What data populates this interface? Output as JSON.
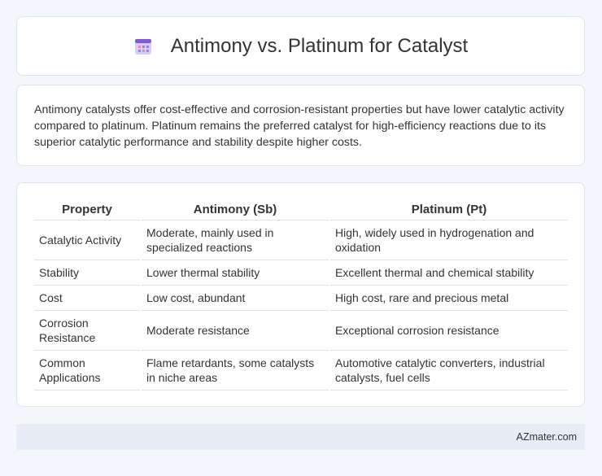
{
  "header": {
    "title": "Antimony vs. Platinum for Catalyst",
    "icon": "calendar-icon"
  },
  "summary": {
    "text": "Antimony catalysts offer cost-effective and corrosion-resistant properties but have lower catalytic activity compared to platinum. Platinum remains the preferred catalyst for high-efficiency reactions due to its superior catalytic performance and stability despite higher costs."
  },
  "table": {
    "headers": [
      "Property",
      "Antimony (Sb)",
      "Platinum (Pt)"
    ],
    "rows": [
      [
        "Catalytic Activity",
        "Moderate, mainly used in specialized reactions",
        "High, widely used in hydrogenation and oxidation"
      ],
      [
        "Stability",
        "Lower thermal stability",
        "Excellent thermal and chemical stability"
      ],
      [
        "Cost",
        "Low cost, abundant",
        "High cost, rare and precious metal"
      ],
      [
        "Corrosion Resistance",
        "Moderate resistance",
        "Exceptional corrosion resistance"
      ],
      [
        "Common Applications",
        "Flame retardants, some catalysts in niche areas",
        "Automotive catalytic converters, industrial catalysts, fuel cells"
      ]
    ]
  },
  "footer": {
    "text": "AZmater.com"
  },
  "colors": {
    "background": "#f3f6fb",
    "card": "#ffffff",
    "footer": "#e6edf7",
    "icon_purple": "#7c5cd6",
    "icon_pink": "#e98bb3"
  }
}
